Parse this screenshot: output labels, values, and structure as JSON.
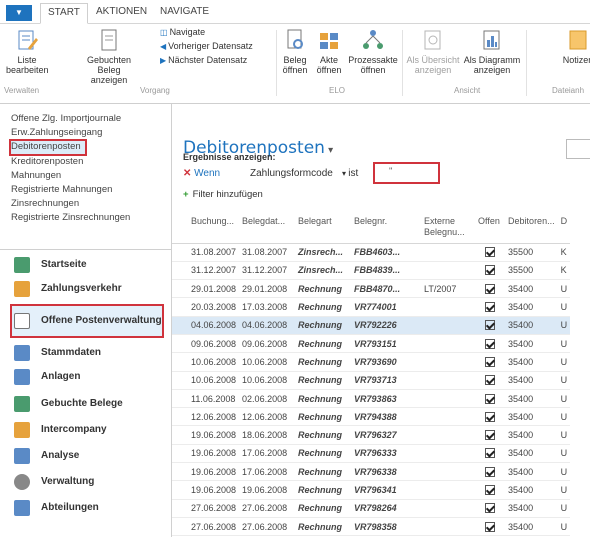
{
  "tabs": [
    "START",
    "AKTIONEN",
    "NAVIGATE"
  ],
  "ribbon": {
    "liste_bearbeiten": "Liste\nbearbeiten",
    "gebuchten_beleg": "Gebuchten Beleg\nanzeigen",
    "navigate": "Navigate",
    "vorheriger": "Vorheriger Datensatz",
    "naechster": "Nächster Datensatz",
    "beleg_oeffnen": "Beleg\nöffnen",
    "akte_oeffnen": "Akte\nöffnen",
    "prozessakte": "Prozessakte\nöffnen",
    "als_uebersicht": "Als Übersicht\nanzeigen",
    "als_diagramm": "Als Diagramm\nanzeigen",
    "notizen": "Notizen",
    "groups": {
      "verwalten": "Verwalten",
      "vorgang": "Vorgang",
      "elo": "ELO",
      "ansicht": "Ansicht",
      "dateianh": "Dateianh"
    }
  },
  "sidebar": {
    "links": [
      "Offene Zlg. Importjournale",
      "Erw.Zahlungseingang",
      "Debitorenposten",
      "Kreditorenposten",
      "Mahnungen",
      "Registrierte Mahnungen",
      "Zinsrechnungen",
      "Registrierte Zinsrechnungen"
    ],
    "modules": [
      "Startseite",
      "Zahlungsverkehr",
      "Offene Postenverwaltung",
      "Stammdaten",
      "Anlagen",
      "Gebuchte Belege",
      "Intercompany",
      "Analyse",
      "Verwaltung",
      "Abteilungen"
    ]
  },
  "page_title": "Debitorenposten",
  "filter": {
    "heading": "Ergebnisse anzeigen:",
    "wenn": "Wenn",
    "field": "Zahlungsformcode",
    "op": "ist",
    "value": "''",
    "add": "Filter hinzufügen"
  },
  "table": {
    "headers": [
      "Buchung...",
      "Belegdat...",
      "Belegart",
      "Belegnr.",
      "Externe\nBelegnu...",
      "Offen",
      "Debitoren...",
      "D"
    ],
    "rows": [
      [
        "31.08.2007",
        "31.08.2007",
        "Zinsrech...",
        "FBB4603...",
        "",
        "✓",
        "35500",
        "K"
      ],
      [
        "31.12.2007",
        "31.12.2007",
        "Zinsrech...",
        "FBB4839...",
        "",
        "✓",
        "35500",
        "K"
      ],
      [
        "29.01.2008",
        "29.01.2008",
        "Rechnung",
        "FBB4870...",
        "LT/2007",
        "✓",
        "35400",
        "U"
      ],
      [
        "20.03.2008",
        "17.03.2008",
        "Rechnung",
        "VR774001",
        "",
        "✓",
        "35400",
        "U"
      ],
      [
        "04.06.2008",
        "04.06.2008",
        "Rechnung",
        "VR792226",
        "",
        "✓",
        "35400",
        "U"
      ],
      [
        "09.06.2008",
        "09.06.2008",
        "Rechnung",
        "VR793151",
        "",
        "✓",
        "35400",
        "U"
      ],
      [
        "10.06.2008",
        "10.06.2008",
        "Rechnung",
        "VR793690",
        "",
        "✓",
        "35400",
        "U"
      ],
      [
        "10.06.2008",
        "10.06.2008",
        "Rechnung",
        "VR793713",
        "",
        "✓",
        "35400",
        "U"
      ],
      [
        "11.06.2008",
        "02.06.2008",
        "Rechnung",
        "VR793863",
        "",
        "✓",
        "35400",
        "U"
      ],
      [
        "12.06.2008",
        "12.06.2008",
        "Rechnung",
        "VR794388",
        "",
        "✓",
        "35400",
        "U"
      ],
      [
        "19.06.2008",
        "18.06.2008",
        "Rechnung",
        "VR796327",
        "",
        "✓",
        "35400",
        "U"
      ],
      [
        "19.06.2008",
        "17.06.2008",
        "Rechnung",
        "VR796333",
        "",
        "✓",
        "35400",
        "U"
      ],
      [
        "19.06.2008",
        "17.06.2008",
        "Rechnung",
        "VR796338",
        "",
        "✓",
        "35400",
        "U"
      ],
      [
        "19.06.2008",
        "19.06.2008",
        "Rechnung",
        "VR796341",
        "",
        "✓",
        "35400",
        "U"
      ],
      [
        "27.06.2008",
        "27.06.2008",
        "Rechnung",
        "VR798264",
        "",
        "✓",
        "35400",
        "U"
      ],
      [
        "27.06.2008",
        "27.06.2008",
        "Rechnung",
        "VR798358",
        "",
        "✓",
        "35400",
        "U"
      ]
    ]
  },
  "colors": {
    "accent": "#1e73be",
    "highlight": "#d0333c",
    "selected_row": "#dbe9f6",
    "red_text": "#c0282e"
  }
}
